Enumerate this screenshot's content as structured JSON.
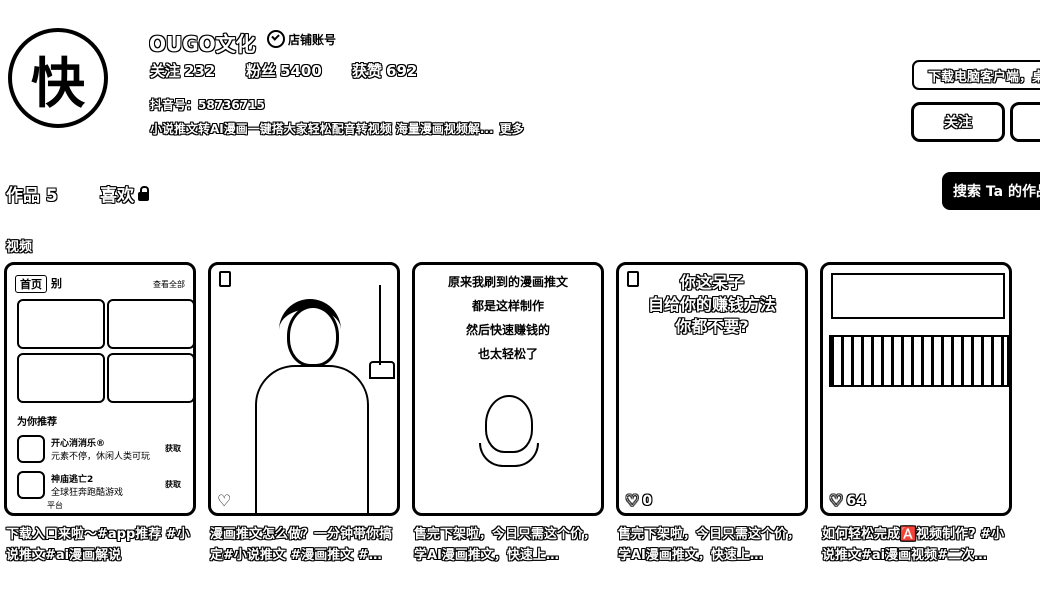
{
  "profile": {
    "avatar_char": "快",
    "name": "OUGO文化",
    "badge_label": "店铺账号",
    "stats": [
      {
        "label": "关注",
        "value": "232"
      },
      {
        "label": "粉丝",
        "value": "5400"
      },
      {
        "label": "获赞",
        "value": "692"
      }
    ],
    "uid": "抖音号：58736715",
    "bio": "小说推文转AI漫画一键搭大家轻松配音转视频 海量漫画视频解...",
    "bio_more": "更多"
  },
  "actions": {
    "download": "下载电脑客户端，桌",
    "follow": "关注",
    "search": "搜索 Ta 的作品"
  },
  "tabs": {
    "works": "作品 5",
    "likes": "喜欢"
  },
  "section_label": "视频",
  "videos": [
    {
      "caption": "下载入口来啦～#app推荐 #小说推文#ai漫画解说",
      "thumb": {
        "tab_active": "首页",
        "tab_other": "别",
        "corner": "查看全部",
        "section": "为你推荐",
        "apps": [
          {
            "name": "开心消消乐®",
            "sub": "元素不停，休闲人类可玩",
            "get": "获取"
          },
          {
            "name": "神庙逃亡2",
            "sub": "全球狂奔跑酷游戏",
            "get": "获取"
          }
        ],
        "bottom": "平台"
      }
    },
    {
      "caption": "漫画推文怎么做？一分钟带你搞定#小说推文 #漫画推文 #…"
    },
    {
      "caption": "售完下架啦，今日只需这个价，学AI漫画推文，快速上…",
      "thumb_lines": [
        "原来我刷到的漫画推文",
        "都是这样制作",
        "然后快速赚钱的",
        "也太轻松了"
      ]
    },
    {
      "caption": "售完下架啦，今日只需这个价，学AI漫画推文，快速上…",
      "thumb_lines": [
        "你这呆子",
        "自给你的赚钱方法",
        "你都不要?"
      ],
      "likes": "0"
    },
    {
      "caption": "如何轻松完成🅰️视频制作? #小说推文#ai漫画视频#二次…",
      "likes": "64"
    }
  ]
}
